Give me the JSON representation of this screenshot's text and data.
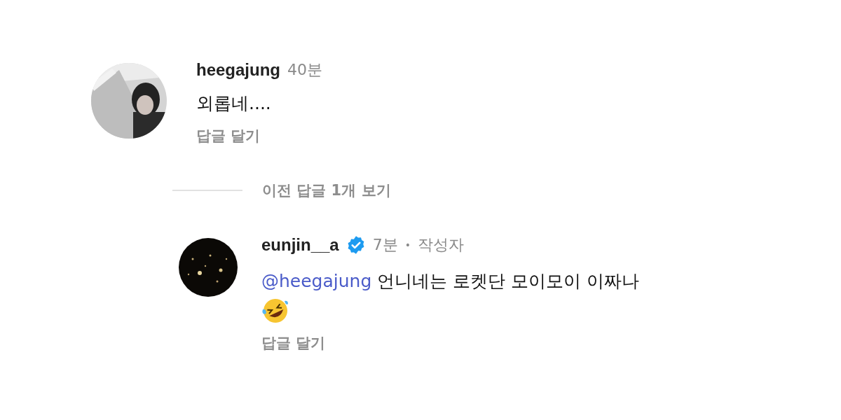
{
  "comment": {
    "username": "heegajung",
    "time": "40분",
    "verified": false,
    "text": "외롭네....",
    "reply_label": "답글 달기"
  },
  "view_replies": "이전 답글 1개 보기",
  "reply": {
    "username": "eunjin__a",
    "verified": true,
    "time": "7분",
    "separator": "•",
    "author_tag": "작성자",
    "mention": "@heegajung",
    "text": "언니네는 로켓단 모이모이 이짜나",
    "reply_label": "답글 달기"
  }
}
